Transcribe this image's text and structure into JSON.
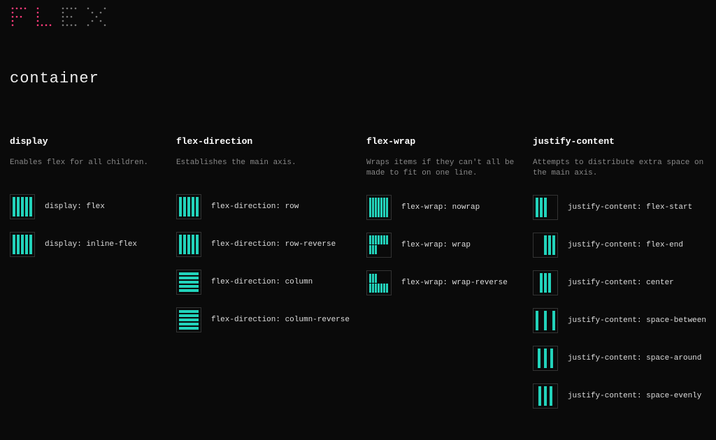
{
  "logo_text": "FLEX",
  "page_title": "container",
  "columns": [
    {
      "title": "display",
      "desc": "Enables flex for all children.",
      "options": [
        {
          "label": "display: flex",
          "icon": "flex-row-fill"
        },
        {
          "label": "display: inline-flex",
          "icon": "flex-row-fill"
        }
      ]
    },
    {
      "title": "flex-direction",
      "desc": "Establishes the main axis.",
      "options": [
        {
          "label": "flex-direction: row",
          "icon": "flex-row-fill"
        },
        {
          "label": "flex-direction: row-reverse",
          "icon": "flex-row-fill-rev"
        },
        {
          "label": "flex-direction: column",
          "icon": "flex-col-fill"
        },
        {
          "label": "flex-direction: column-reverse",
          "icon": "flex-col-fill-rev"
        }
      ]
    },
    {
      "title": "flex-wrap",
      "desc": "Wraps items if they can't all be made to fit on one line.",
      "options": [
        {
          "label": "flex-wrap: nowrap",
          "icon": "wrap-nowrap"
        },
        {
          "label": "flex-wrap: wrap",
          "icon": "wrap-wrap"
        },
        {
          "label": "flex-wrap: wrap-reverse",
          "icon": "wrap-wrap-reverse"
        }
      ]
    },
    {
      "title": "justify-content",
      "desc": "Attempts to distribute extra space on the main axis.",
      "options": [
        {
          "label": "justify-content: flex-start",
          "icon": "jc-flex-start"
        },
        {
          "label": "justify-content: flex-end",
          "icon": "jc-flex-end"
        },
        {
          "label": "justify-content: center",
          "icon": "jc-center"
        },
        {
          "label": "justify-content: space-between",
          "icon": "jc-space-between"
        },
        {
          "label": "justify-content: space-around",
          "icon": "jc-space-around"
        },
        {
          "label": "justify-content: space-evenly",
          "icon": "jc-space-evenly"
        }
      ]
    }
  ],
  "colors": {
    "accent": "#22d3bb",
    "logo_pink": "#ff3b7b"
  }
}
